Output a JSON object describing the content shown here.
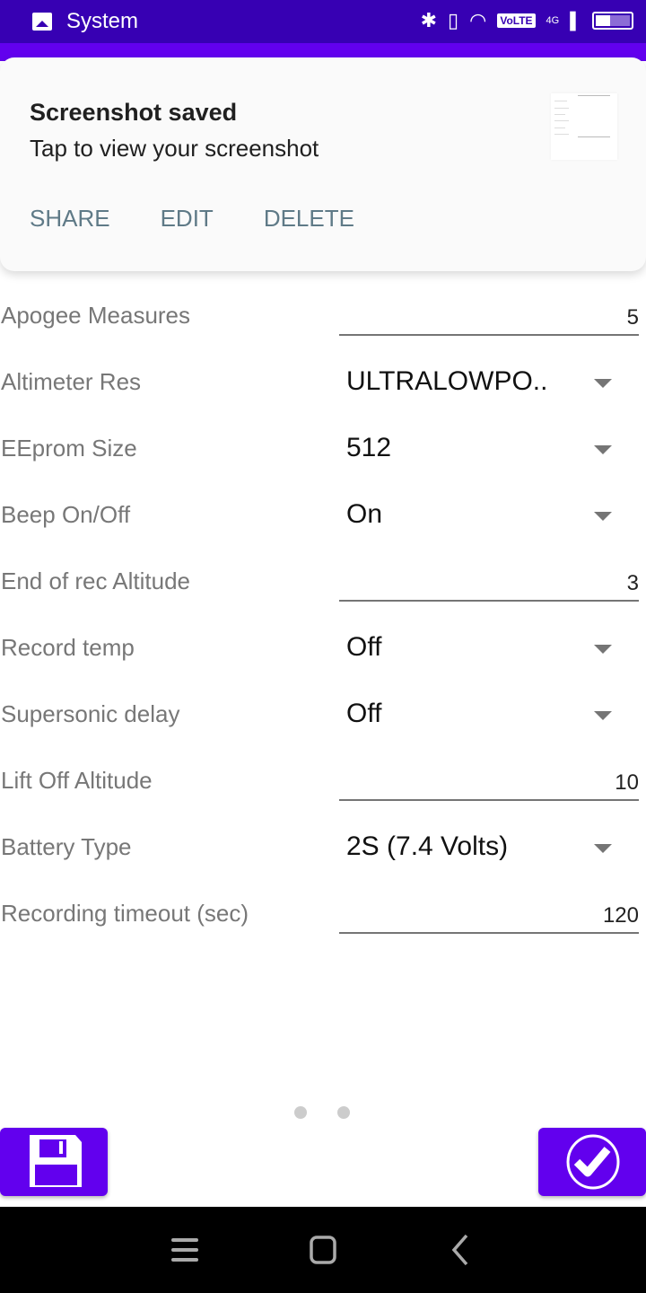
{
  "status_bar": {
    "app_name": "System",
    "volte_label": "VoLTE",
    "network_label": "4G",
    "battery_level_percent": 35
  },
  "notification": {
    "title": "Screenshot saved",
    "subtitle": "Tap to view your screenshot",
    "actions": [
      {
        "label": "SHARE"
      },
      {
        "label": "EDIT"
      },
      {
        "label": "DELETE"
      }
    ]
  },
  "form": {
    "fields": [
      {
        "label": "Apogee Measures",
        "type": "input",
        "value": "5"
      },
      {
        "label": "Altimeter Res",
        "type": "select",
        "value": "ULTRALOWPO.."
      },
      {
        "label": "EEprom Size",
        "type": "select",
        "value": "512"
      },
      {
        "label": "Beep On/Off",
        "type": "select",
        "value": "On"
      },
      {
        "label": "End of rec Altitude",
        "type": "input",
        "value": "3"
      },
      {
        "label": "Record temp",
        "type": "select",
        "value": "Off"
      },
      {
        "label": "Supersonic delay",
        "type": "select",
        "value": "Off"
      },
      {
        "label": "Lift Off Altitude",
        "type": "input",
        "value": "10"
      },
      {
        "label": "Battery Type",
        "type": "select",
        "value": "2S (7.4 Volts)"
      },
      {
        "label": "Recording timeout (sec)",
        "type": "input",
        "value": "120"
      }
    ]
  },
  "pager": {
    "pages": 2,
    "current": 1
  },
  "colors": {
    "accent": "#6200ee",
    "status_bar": "#3700b3",
    "action_text": "#5f7a87"
  }
}
